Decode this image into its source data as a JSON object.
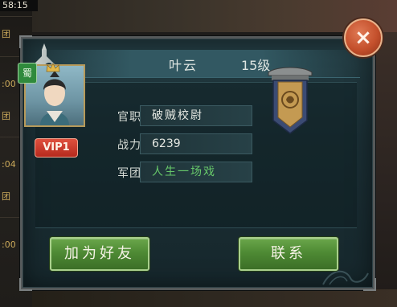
{
  "scene": {
    "timer": "58:15",
    "side_labels": [
      "团",
      ":00",
      "团",
      ":04",
      "团",
      ":00"
    ]
  },
  "profile": {
    "name": "叶云",
    "level": "15级",
    "faction": "蜀",
    "vip": "VIP1",
    "fields": [
      {
        "label": "官职:",
        "value": "破贼校尉"
      },
      {
        "label": "战力:",
        "value": "6239"
      },
      {
        "label": "军团:",
        "value": "人生一场戏"
      }
    ]
  },
  "actions": {
    "add_friend": "加为好友",
    "contact": "联系",
    "close": "×"
  },
  "colors": {
    "legion_text": "#67c86a",
    "button_green": "#4e8a34",
    "close_red": "#c4502c",
    "vip_red": "#b52a1e"
  }
}
